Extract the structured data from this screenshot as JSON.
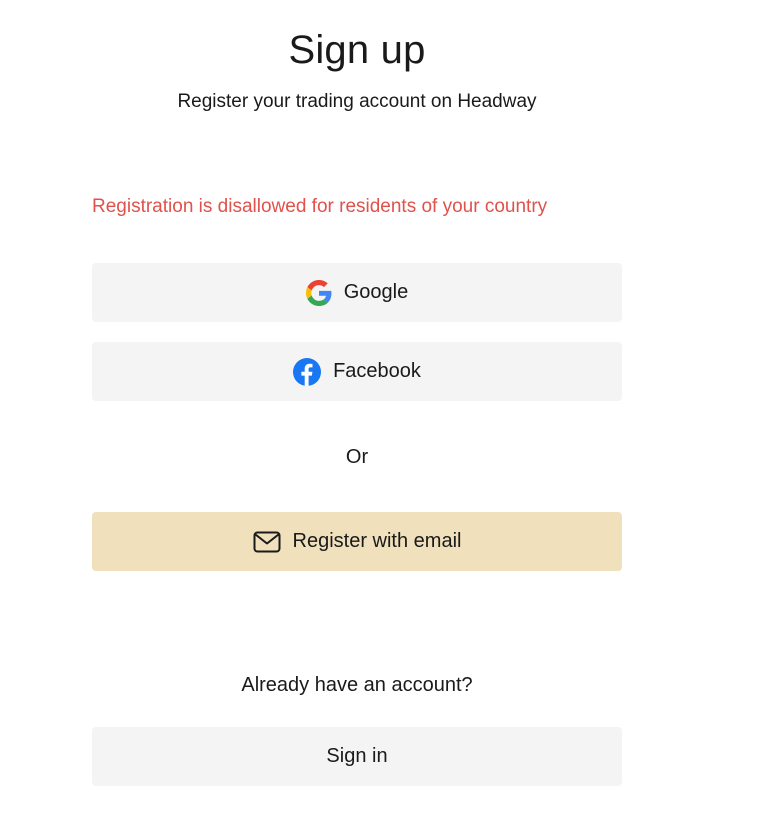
{
  "header": {
    "title": "Sign up",
    "subtitle": "Register your trading account on Headway"
  },
  "error_message": "Registration is disallowed for residents of your country",
  "social": {
    "google_label": "Google",
    "facebook_label": "Facebook"
  },
  "divider_text": "Or",
  "email_button_label": "Register with email",
  "signin": {
    "prompt": "Already have an account?",
    "button_label": "Sign in"
  },
  "colors": {
    "error": "#e0524c",
    "email_button_bg": "#f0e0bb",
    "button_bg": "#f4f4f4",
    "facebook_blue": "#1877f2"
  },
  "icons": {
    "google": "google-icon",
    "facebook": "facebook-icon",
    "email": "mail-icon"
  }
}
